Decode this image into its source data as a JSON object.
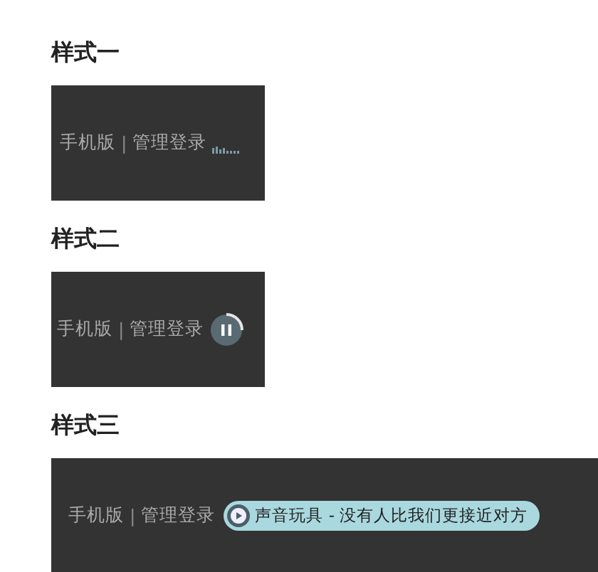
{
  "sections": [
    {
      "title": "样式一",
      "links": [
        "手机版",
        "管理登录"
      ],
      "separator": "|",
      "player": {
        "kind": "bars"
      }
    },
    {
      "title": "样式二",
      "links": [
        "手机版",
        "管理登录"
      ],
      "separator": "|",
      "player": {
        "kind": "pause"
      }
    },
    {
      "title": "样式三",
      "links": [
        "手机版",
        "管理登录"
      ],
      "separator": "|",
      "player": {
        "kind": "label",
        "label": "声音玩具 - 没有人比我们更接近对方"
      }
    }
  ]
}
